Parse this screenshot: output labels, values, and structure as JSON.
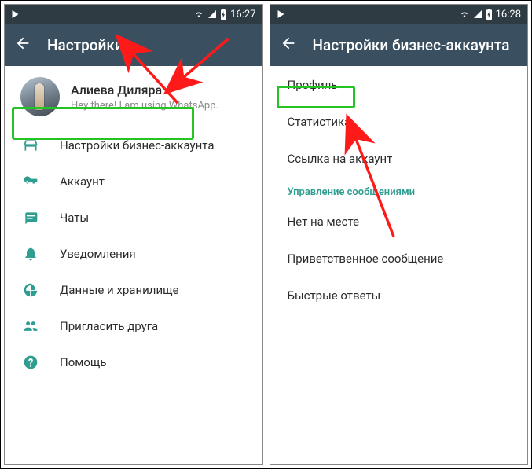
{
  "left": {
    "status_time": "16:27",
    "app_title": "Настройки",
    "profile": {
      "name": "Алиева Диляра",
      "status": "Hey there! I am using WhatsApp."
    },
    "items": [
      {
        "icon": "storefront",
        "label": "Настройки бизнес-аккаунта"
      },
      {
        "icon": "key",
        "label": "Аккаунт"
      },
      {
        "icon": "chat",
        "label": "Чаты"
      },
      {
        "icon": "bell",
        "label": "Уведомления"
      },
      {
        "icon": "data",
        "label": "Данные и хранилище"
      },
      {
        "icon": "invite",
        "label": "Пригласить друга"
      },
      {
        "icon": "help",
        "label": "Помощь"
      }
    ]
  },
  "right": {
    "status_time": "16:28",
    "app_title": "Настройки бизнес-аккаунта",
    "items_top": [
      "Профиль",
      "Статистика",
      "Ссылка на аккаунт"
    ],
    "section_header": "Управление сообщениями",
    "items_bottom": [
      "Нет на месте",
      "Приветственное сообщение",
      "Быстрые ответы"
    ]
  },
  "annotation_color": "#ff1a1a",
  "highlight_color": "#23c423"
}
